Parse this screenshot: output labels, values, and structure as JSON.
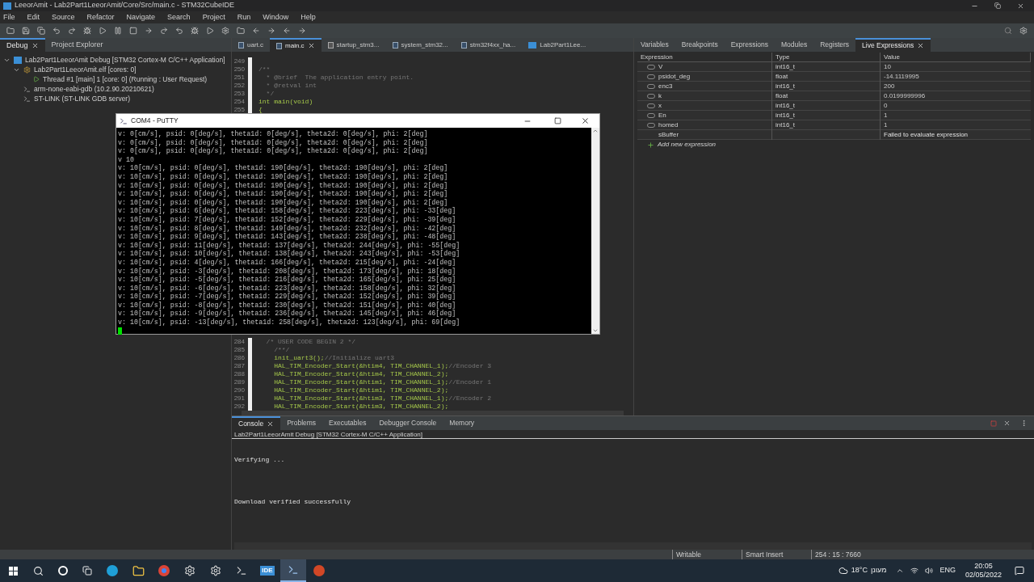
{
  "window": {
    "title": "LeeorAmit - Lab2Part1LeeorAmit/Core/Src/main.c - STM32CubeIDE"
  },
  "menu": [
    "File",
    "Edit",
    "Source",
    "Refactor",
    "Navigate",
    "Search",
    "Project",
    "Run",
    "Window",
    "Help"
  ],
  "debug_panel": {
    "tabs": [
      {
        "label": "Debug",
        "selected": true
      },
      {
        "label": "Project Explorer",
        "selected": false
      }
    ],
    "tree": [
      {
        "label": "Lab2Part1LeeorAmit Debug [STM32 Cortex-M C/C++ Application]",
        "kind": "launch",
        "expanded": true,
        "children": [
          {
            "label": "Lab2Part1LeeorAmit.elf [cores: 0]",
            "kind": "process",
            "expanded": true,
            "children": [
              {
                "label": "Thread #1 [main] 1 [core: 0] (Running : User Request)",
                "kind": "thread"
              }
            ]
          },
          {
            "label": "arm-none-eabi-gdb (10.2.90.20210621)",
            "kind": "server"
          },
          {
            "label": "ST-LINK (ST-LINK GDB server)",
            "kind": "server"
          }
        ]
      }
    ]
  },
  "editor": {
    "tabs": [
      {
        "label": "uart.c",
        "selected": false,
        "kind": "c"
      },
      {
        "label": "main.c",
        "selected": true,
        "kind": "c"
      },
      {
        "label": "startup_stm3...",
        "selected": false,
        "kind": "s"
      },
      {
        "label": "system_stm32...",
        "selected": false,
        "kind": "c"
      },
      {
        "label": "stm32f4xx_ha...",
        "selected": false,
        "kind": "c"
      },
      {
        "label": "Lab2Part1Lee...",
        "selected": false,
        "kind": "mx"
      }
    ],
    "top_lines": [
      {
        "number": "249"
      },
      {
        "number": "250",
        "comment": "/**"
      },
      {
        "number": "251",
        "comment": "  * @brief  The application entry point."
      },
      {
        "number": "252",
        "comment": "  * @retval int"
      },
      {
        "number": "253",
        "comment": "  */"
      },
      {
        "number": "254",
        "code": "int main(void)"
      },
      {
        "number": "255",
        "code": "{"
      }
    ],
    "bottom_lines": [
      {
        "number": "284",
        "comment": "  /* USER CODE BEGIN 2 */"
      },
      {
        "number": "285",
        "comment": "    /**/"
      },
      {
        "number": "286",
        "code": "    init_uart3();",
        "comment": "//Initialize uart3"
      },
      {
        "number": "287",
        "code": "    HAL_TIM_Encoder_Start(&htim4, TIM_CHANNEL_1);",
        "comment": "//Encoder 3"
      },
      {
        "number": "288",
        "code": "    HAL_TIM_Encoder_Start(&htim4, TIM_CHANNEL_2);"
      },
      {
        "number": "289",
        "code": "    HAL_TIM_Encoder_Start(&htim1, TIM_CHANNEL_1);",
        "comment": "//Encoder 1"
      },
      {
        "number": "290",
        "code": "    HAL_TIM_Encoder_Start(&htim1, TIM_CHANNEL_2);"
      },
      {
        "number": "291",
        "code": "    HAL_TIM_Encoder_Start(&htim3, TIM_CHANNEL_1);",
        "comment": "//Encoder 2"
      },
      {
        "number": "292",
        "code": "    HAL_TIM_Encoder_Start(&htim3, TIM_CHANNEL_2);"
      }
    ]
  },
  "debug_views": {
    "tabs": [
      {
        "label": "Variables",
        "selected": false
      },
      {
        "label": "Breakpoints",
        "selected": false
      },
      {
        "label": "Expressions",
        "selected": false
      },
      {
        "label": "Modules",
        "selected": false
      },
      {
        "label": "Registers",
        "selected": false
      },
      {
        "label": "Live Expressions",
        "selected": true
      }
    ],
    "columns": [
      "Expression",
      "Type",
      "Value"
    ],
    "rows": [
      {
        "kind": "variable",
        "expression": "V",
        "type": "int16_t",
        "value": "10"
      },
      {
        "kind": "variable",
        "expression": "psidot_deg",
        "type": "float",
        "value": "-14.1119995"
      },
      {
        "kind": "variable",
        "expression": "enc3",
        "type": "int16_t",
        "value": "200"
      },
      {
        "kind": "variable",
        "expression": "k",
        "type": "float",
        "value": "0.0199999996"
      },
      {
        "kind": "variable",
        "expression": "x",
        "type": "int16_t",
        "value": "0"
      },
      {
        "kind": "variable",
        "expression": "En",
        "type": "int16_t",
        "value": "1"
      },
      {
        "kind": "variable",
        "expression": "homed",
        "type": "int16_t",
        "value": "1"
      },
      {
        "kind": "error",
        "expression": "sBuffer",
        "value": "Failed to evaluate expression"
      }
    ],
    "add_label": "Add new expression"
  },
  "console": {
    "tabs": [
      {
        "label": "Console",
        "selected": true
      },
      {
        "label": "Problems",
        "selected": false
      },
      {
        "label": "Executables",
        "selected": false
      },
      {
        "label": "Debugger Console",
        "selected": false
      },
      {
        "label": "Memory",
        "selected": false
      }
    ],
    "subtitle": "Lab2Part1LeeorAmit Debug [STM32 Cortex-M C/C++ Application]",
    "lines": [
      "Verifying ...",
      "Download verified successfully"
    ]
  },
  "status_bar": [
    "Writable",
    "Smart Insert",
    "254 : 15 : 7660"
  ],
  "putty": {
    "title": "COM4 - PuTTY",
    "lines": [
      "v: 0[cm/s], psid: 0[deg/s], theta1d: 0[deg/s], theta2d: 0[deg/s], phi: 2[deg]",
      "v: 0[cm/s], psid: 0[deg/s], theta1d: 0[deg/s], theta2d: 0[deg/s], phi: 2[deg]",
      "v: 0[cm/s], psid: 0[deg/s], theta1d: 0[deg/s], theta2d: 0[deg/s], phi: 2[deg]",
      "v 10",
      "v: 10[cm/s], psid: 0[deg/s], theta1d: 190[deg/s], theta2d: 190[deg/s], phi: 2[deg]",
      "v: 10[cm/s], psid: 0[deg/s], theta1d: 190[deg/s], theta2d: 190[deg/s], phi: 2[deg]",
      "v: 10[cm/s], psid: 0[deg/s], theta1d: 190[deg/s], theta2d: 190[deg/s], phi: 2[deg]",
      "v: 10[cm/s], psid: 0[deg/s], theta1d: 190[deg/s], theta2d: 190[deg/s], phi: 2[deg]",
      "v: 10[cm/s], psid: 0[deg/s], theta1d: 190[deg/s], theta2d: 190[deg/s], phi: 2[deg]",
      "v: 10[cm/s], psid: 6[deg/s], theta1d: 158[deg/s], theta2d: 223[deg/s], phi: -33[deg]",
      "v: 10[cm/s], psid: 7[deg/s], theta1d: 152[deg/s], theta2d: 229[deg/s], phi: -39[deg]",
      "v: 10[cm/s], psid: 8[deg/s], theta1d: 149[deg/s], theta2d: 232[deg/s], phi: -42[deg]",
      "v: 10[cm/s], psid: 9[deg/s], theta1d: 143[deg/s], theta2d: 238[deg/s], phi: -48[deg]",
      "v: 10[cm/s], psid: 11[deg/s], theta1d: 137[deg/s], theta2d: 244[deg/s], phi: -55[deg]",
      "v: 10[cm/s], psid: 10[deg/s], theta1d: 138[deg/s], theta2d: 243[deg/s], phi: -53[deg]",
      "v: 10[cm/s], psid: 4[deg/s], theta1d: 166[deg/s], theta2d: 215[deg/s], phi: -24[deg]",
      "v: 10[cm/s], psid: -3[deg/s], theta1d: 208[deg/s], theta2d: 173[deg/s], phi: 18[deg]",
      "v: 10[cm/s], psid: -5[deg/s], theta1d: 216[deg/s], theta2d: 165[deg/s], phi: 25[deg]",
      "v: 10[cm/s], psid: -6[deg/s], theta1d: 223[deg/s], theta2d: 158[deg/s], phi: 32[deg]",
      "v: 10[cm/s], psid: -7[deg/s], theta1d: 229[deg/s], theta2d: 152[deg/s], phi: 39[deg]",
      "v: 10[cm/s], psid: -8[deg/s], theta1d: 230[deg/s], theta2d: 151[deg/s], phi: 40[deg]",
      "v: 10[cm/s], psid: -9[deg/s], theta1d: 236[deg/s], theta2d: 145[deg/s], phi: 46[deg]",
      "v: 10[cm/s], psid: -13[deg/s], theta1d: 258[deg/s], theta2d: 123[deg/s], phi: 69[deg]"
    ]
  },
  "taskbar": {
    "apps": [
      {
        "kind": "edge",
        "selected": false
      },
      {
        "kind": "folder",
        "selected": false
      },
      {
        "kind": "chrome",
        "selected": false
      },
      {
        "kind": "tool",
        "selected": false
      },
      {
        "kind": "tool",
        "selected": false
      },
      {
        "kind": "terminal",
        "selected": false
      },
      {
        "kind": "ide",
        "selected": false
      },
      {
        "kind": "putty",
        "selected": true
      },
      {
        "kind": "powerpoint",
        "selected": false
      }
    ],
    "ide_label": "IDE",
    "temperature": "18°C",
    "weather": "מעונן",
    "language": "ENG",
    "time": "20:05",
    "date": "02/05/2022"
  }
}
